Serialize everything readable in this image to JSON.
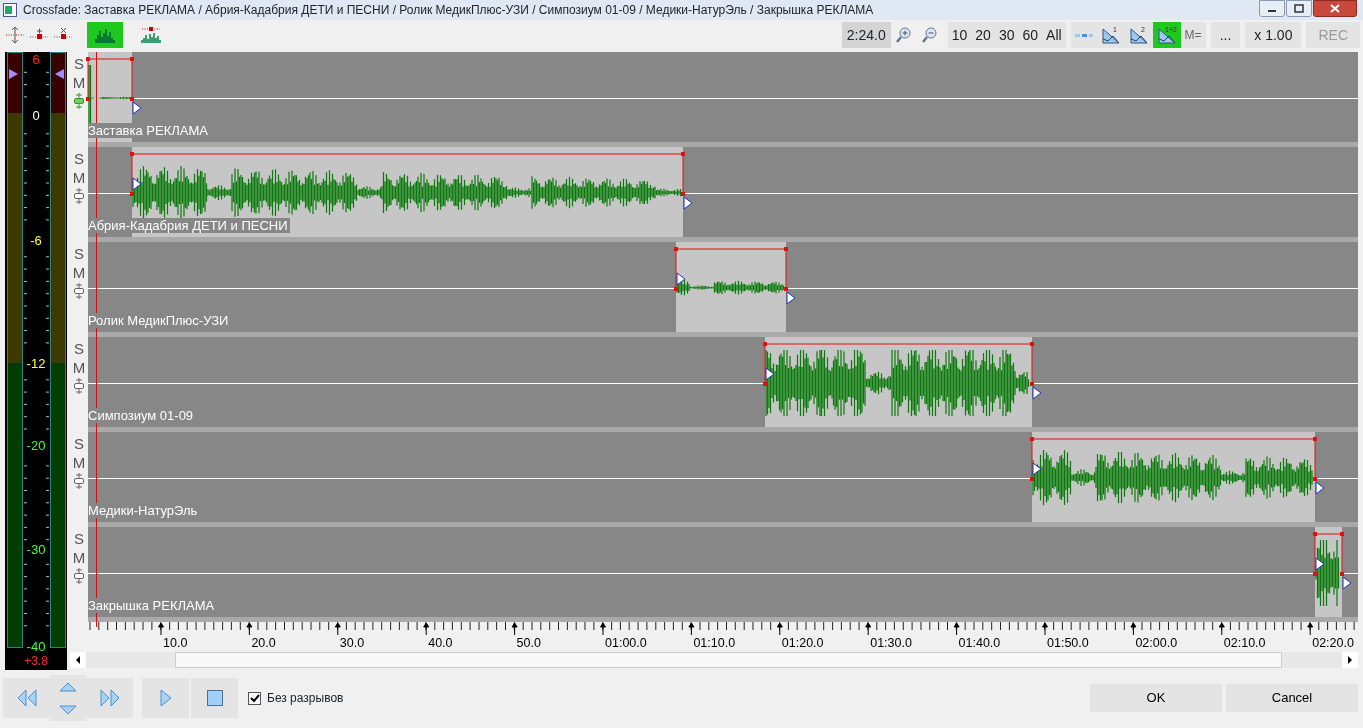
{
  "window": {
    "title": "Crossfade: Заставка РЕКЛАМА / Абрия-Кадабрия ДЕТИ и ПЕСНИ / Ролик МедикПлюс-УЗИ / Симпозиум 01-09 / Медики-НатурЭль / Закрышка РЕКЛАМА"
  },
  "toolbar_left": [
    {
      "kind": "arrows",
      "selected": false
    },
    {
      "kind": "marker",
      "selected": false
    },
    {
      "kind": "cross",
      "selected": false
    },
    {
      "kind": "wave",
      "selected": true
    },
    {
      "kind": "wave_marker",
      "selected": false
    }
  ],
  "toolbar_right": {
    "duration": "2:24.0",
    "zoom_presets": [
      "10",
      "20",
      "30",
      "60",
      "All"
    ],
    "view_modes": [
      {
        "kind": "dots",
        "selected": false
      },
      {
        "kind": "channel",
        "label": "1",
        "selected": false
      },
      {
        "kind": "channel",
        "label": "2",
        "selected": false
      },
      {
        "kind": "channel",
        "label": "1+2",
        "selected": true
      }
    ],
    "mono": "M=",
    "more": "...",
    "speed": "x 1.00",
    "rec": {
      "label": "REC",
      "disabled": true
    }
  },
  "meter": {
    "scale": [
      {
        "label": "6",
        "color": "#ff2020"
      },
      {
        "label": "0",
        "color": "#ffffff"
      },
      {
        "label": "-6",
        "color": "#ffff40"
      },
      {
        "label": "-12",
        "color": "#ffff40"
      },
      {
        "label": "-20",
        "color": "#40ff40"
      },
      {
        "label": "-30",
        "color": "#40ff40"
      },
      {
        "label": "-40",
        "color": "#40ff40"
      }
    ],
    "readout": "+3.8"
  },
  "tracks": [
    {
      "name": "Заставка РЕКЛАМА",
      "solo": "S",
      "mute": "M",
      "selected": true
    },
    {
      "name": "Абрия-Кадабрия ДЕТИ и ПЕСНИ",
      "solo": "S",
      "mute": "M",
      "selected": false
    },
    {
      "name": "Ролик МедикПлюс-УЗИ",
      "solo": "S",
      "mute": "M",
      "selected": false
    },
    {
      "name": "Симпозиум 01-09",
      "solo": "S",
      "mute": "M",
      "selected": false
    },
    {
      "name": "Медики-НатурЭль",
      "solo": "S",
      "mute": "M",
      "selected": false
    },
    {
      "name": "Закрышка РЕКЛАМА",
      "solo": "S",
      "mute": "M",
      "selected": false
    }
  ],
  "ruler": {
    "ticks": [
      "10.0",
      "20.0",
      "30.0",
      "40.0",
      "50.0",
      "01:00.0",
      "01:10.0",
      "01:20.0",
      "01:30.0",
      "01:40.0",
      "01:50.0",
      "02:00.0",
      "02:10.0",
      "02:20.0"
    ]
  },
  "transport": {
    "seamless": {
      "label": "Без разрывов",
      "checked": true
    }
  },
  "buttons": [
    "OK",
    "Cancel"
  ]
}
